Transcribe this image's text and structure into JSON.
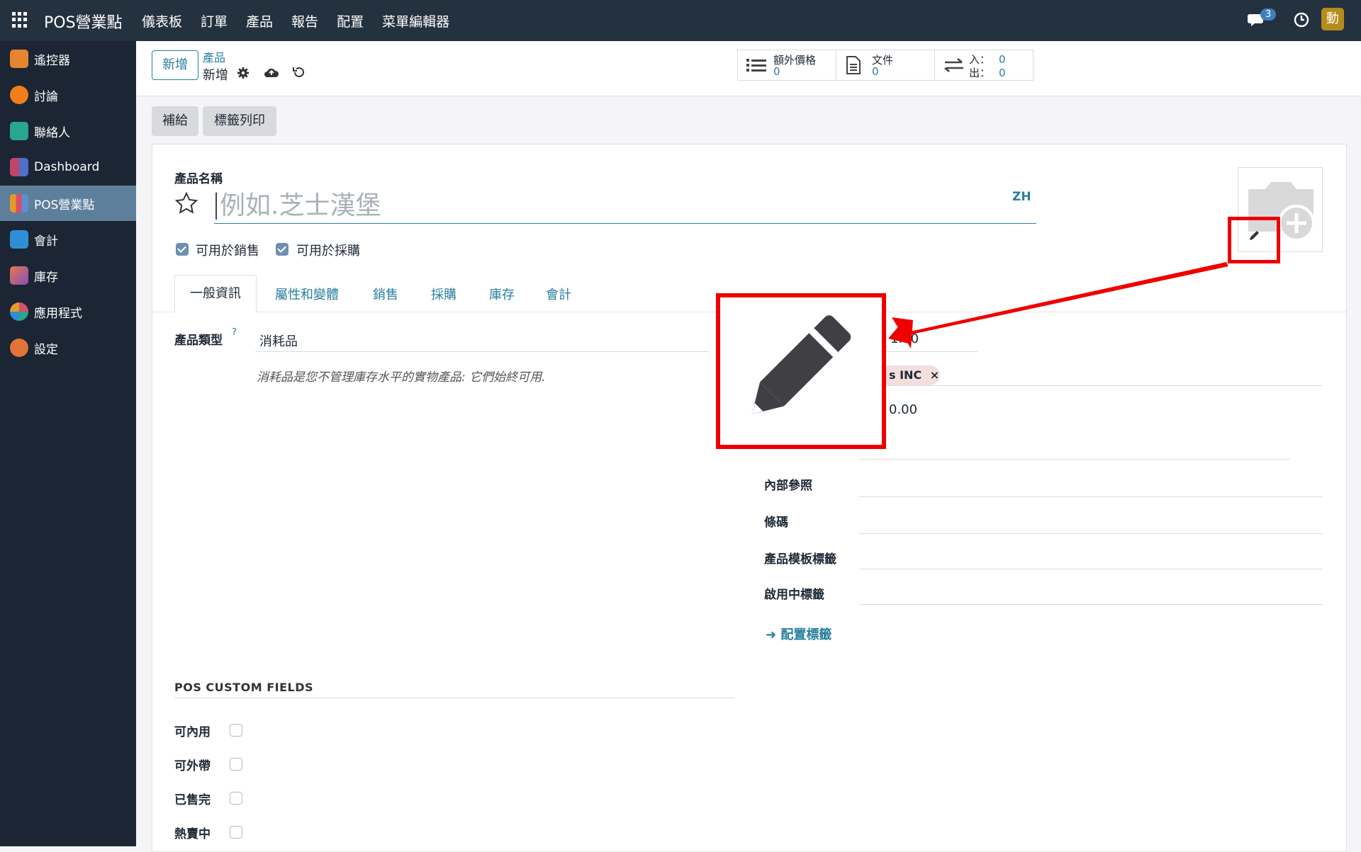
{
  "topbar": {
    "brand": "POS營業點",
    "menu": [
      "儀表板",
      "訂單",
      "產品",
      "報告",
      "配置",
      "菜單編輯器"
    ],
    "chat_count": "3",
    "user_initial": "動"
  },
  "sidebar": {
    "items": [
      {
        "label": "遙控器",
        "color": "#e5852f"
      },
      {
        "label": "討論",
        "color": "#f07f1a"
      },
      {
        "label": "聯絡人",
        "color": "#2aa58f"
      },
      {
        "label": "Dashboard",
        "color": "#c2456b"
      },
      {
        "label": "POS營業點",
        "color": "#e59a2c"
      },
      {
        "label": "會計",
        "color": "#2f8fd6"
      },
      {
        "label": "庫存",
        "color": "#e2774e"
      },
      {
        "label": "應用程式",
        "color": "#d64f6c"
      },
      {
        "label": "設定",
        "color": "#e27438"
      }
    ]
  },
  "control": {
    "new_button": "新增",
    "breadcrumb_parent": "產品",
    "breadcrumb_current": "新增",
    "stats": {
      "extra_price_label": "額外價格",
      "extra_price_value": "0",
      "documents_label": "文件",
      "documents_value": "0",
      "in_label": "入：",
      "in_value": "0",
      "out_label": "出：",
      "out_value": "0"
    }
  },
  "actions": {
    "replenish": "補給",
    "print_labels": "標籤列印"
  },
  "form": {
    "product_name_label": "產品名稱",
    "product_name_placeholder": "例如.芝士漢堡",
    "lang": "ZH",
    "can_be_sold": "可用於銷售",
    "can_be_purchased": "可用於採購",
    "tabs": [
      "一般資訊",
      "屬性和變體",
      "銷售",
      "採購",
      "庫存",
      "會計"
    ],
    "product_type_label": "產品類型",
    "product_type_help_mark": "?",
    "product_type_value": "消耗品",
    "product_type_help": "消耗品是您不管理庫存水平的實物產品: 它們始終可用.",
    "sales_price_partial": "1.00",
    "tax_tag_partial": "s INC",
    "tax_remove": "×",
    "cost_value": "0.00",
    "internal_ref_label": "內部參照",
    "barcode_label": "條碼",
    "template_tags_label": "產品模板標籤",
    "active_tags_label": "啟用中標籤",
    "configure_tags_link": "配置標籤",
    "pos_section_title": "POS CUSTOM FIELDS",
    "pos_fields": [
      "可內用",
      "可外帶",
      "已售完",
      "熱賣中"
    ]
  }
}
